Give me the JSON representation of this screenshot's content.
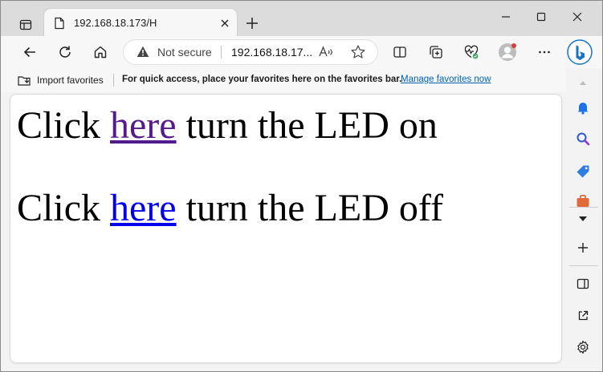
{
  "tab": {
    "title": "192.168.18.173/H"
  },
  "address": {
    "security_label": "Not secure",
    "url": "192.168.18.17..."
  },
  "favorites_bar": {
    "import_label": "Import favorites",
    "hint": "For quick access, place your favorites here on the favorites bar.",
    "manage_link": "Manage favorites now"
  },
  "page": {
    "line_on": {
      "prefix": "Click ",
      "link": "here",
      "suffix": " turn the LED on"
    },
    "line_off": {
      "prefix": "Click ",
      "link": "here",
      "suffix": " turn the LED off"
    }
  },
  "colors": {
    "visited_link": "#551a8b",
    "unvisited_link": "#0000ee",
    "favorites_link": "#0063b1",
    "warning_icon": "#444444"
  },
  "icons": {
    "tab_actions": "tab-actions-icon",
    "page": "page-icon",
    "close": "close-icon",
    "new_tab": "plus-icon",
    "back": "back-arrow-icon",
    "refresh": "refresh-icon",
    "home": "home-icon",
    "warning": "warning-triangle-icon",
    "read_aloud": "read-aloud-icon",
    "favorite": "star-icon",
    "split_screen": "split-screen-icon",
    "collections": "collections-icon",
    "browser_essentials": "heart-pulse-icon",
    "profile": "profile-avatar-icon",
    "more": "more-dots-icon",
    "bing": "bing-icon",
    "bell": "bell-icon",
    "search": "search-icon",
    "tag": "tag-icon",
    "briefcase": "briefcase-icon",
    "dropdown": "chevron-down-icon",
    "add": "plus-icon",
    "sidebar_toggle": "sidebar-toggle-icon",
    "open_external": "external-link-icon",
    "settings": "gear-icon"
  }
}
